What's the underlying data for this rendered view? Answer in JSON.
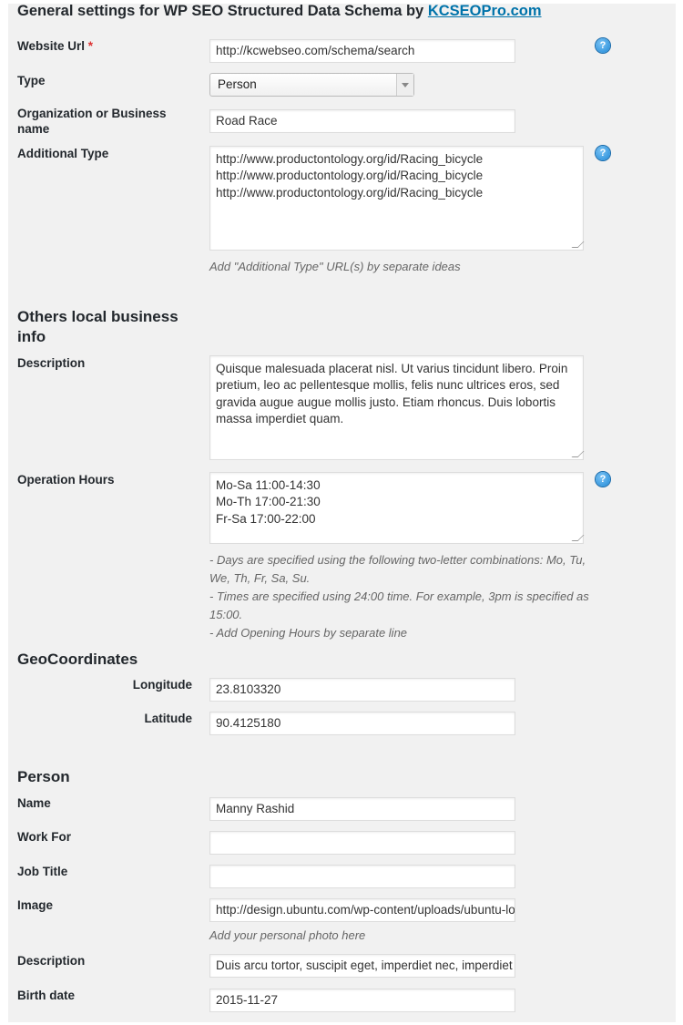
{
  "title": {
    "text": "General settings for WP SEO Structured Data Schema by ",
    "link": "KCSEOPro.com"
  },
  "general": {
    "website_url": {
      "label": "Website Url",
      "required": "*",
      "value": "http://kcwebseo.com/schema/search"
    },
    "type": {
      "label": "Type",
      "value": "Person"
    },
    "org_name": {
      "label": "Organization or Business name",
      "value": "Road Race"
    },
    "additional_type": {
      "label": "Additional Type",
      "value": "http://www.productontology.org/id/Racing_bicycle\nhttp://www.productontology.org/id/Racing_bicycle\nhttp://www.productontology.org/id/Racing_bicycle",
      "hint": "Add \"Additional Type\" URL(s) by separate ideas"
    }
  },
  "local": {
    "heading": "Others local business info",
    "description": {
      "label": "Description",
      "value": "Quisque malesuada placerat nisl. Ut varius tincidunt libero. Proin pretium, leo ac pellentesque mollis, felis nunc ultrices eros, sed gravida augue augue mollis justo. Etiam rhoncus. Duis lobortis massa imperdiet quam."
    },
    "hours": {
      "label": "Operation Hours",
      "value": "Mo-Sa 11:00-14:30\nMo-Th 17:00-21:30\nFr-Sa 17:00-22:00",
      "hints": [
        "- Days are specified using the following two-letter combinations: Mo, Tu, We, Th, Fr, Sa, Su.",
        "- Times are specified using 24:00 time. For example, 3pm is specified as 15:00.",
        "- Add Opening Hours by separate line"
      ]
    }
  },
  "geo": {
    "heading": "GeoCoordinates",
    "longitude": {
      "label": "Longitude",
      "value": "23.8103320"
    },
    "latitude": {
      "label": "Latitude",
      "value": "90.4125180"
    }
  },
  "person": {
    "heading": "Person",
    "name": {
      "label": "Name",
      "value": "Manny Rashid"
    },
    "work_for": {
      "label": "Work For",
      "value": ""
    },
    "job_title": {
      "label": "Job Title",
      "value": ""
    },
    "image": {
      "label": "Image",
      "value": "http://design.ubuntu.com/wp-content/uploads/ubuntu-logo.png",
      "hint": "Add your personal photo here"
    },
    "description": {
      "label": "Description",
      "value": "Duis arcu tortor, suscipit eget, imperdiet nec, imperdiet iaculis"
    },
    "birth_date": {
      "label": "Birth date",
      "value": "2015-11-27"
    }
  },
  "icons": {
    "help": "help-question-icon",
    "help_glyph": "?"
  },
  "colors": {
    "link": "#0073aa",
    "required": "#dc3232",
    "panel": "#f1f1f1",
    "help": "#1e88d6"
  }
}
